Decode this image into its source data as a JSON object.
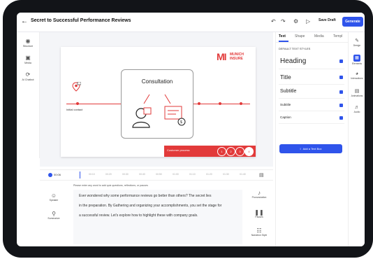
{
  "header": {
    "title": "Secret to Successful Performance Reviews",
    "save_draft": "Save Draft",
    "generate": "Generate"
  },
  "left_rail": {
    "items": [
      {
        "label": "Structure",
        "icon": "structure-icon"
      },
      {
        "label": "Media",
        "icon": "media-icon"
      },
      {
        "label": "AI Chatbot",
        "icon": "ai-chatbot-icon"
      }
    ]
  },
  "slide": {
    "logo_mark": "MI",
    "logo_line1": "MUNICH",
    "logo_line2": "INSURE",
    "consultation": "Consultation",
    "initial_contact": "Initial contact",
    "bar_label": "Customer process",
    "steps": [
      "1",
      "2",
      "3",
      "4"
    ]
  },
  "right_panel": {
    "tabs": [
      "Text",
      "Shape",
      "Media",
      "Templ"
    ],
    "section_title": "DEFAULT TEXT STYLES",
    "styles": [
      "Heading",
      "Title",
      "Subtitle",
      "Subtitle",
      "Caption"
    ],
    "add_button": "Add a Text Box"
  },
  "far_right": {
    "items": [
      {
        "label": "Design",
        "icon": "design-icon"
      },
      {
        "label": "Elements",
        "icon": "elements-icon"
      },
      {
        "label": "Interactions",
        "icon": "interactions-icon"
      },
      {
        "label": "Animations",
        "icon": "animations-icon"
      },
      {
        "label": "Audio",
        "icon": "audio-icon"
      }
    ]
  },
  "timeline": {
    "time": "00:06",
    "ticks": [
      "00:10",
      "00:20",
      "00:30",
      "00:40",
      "00:50",
      "01:00",
      "01:10",
      "01:20",
      "01:30",
      "01:40"
    ]
  },
  "bottom_left": {
    "items": [
      {
        "label": "Speaker"
      },
      {
        "label": "Summarize"
      }
    ]
  },
  "bottom_right": {
    "items": [
      {
        "label": "Pronunciation"
      },
      {
        "label": "Pauses"
      },
      {
        "label": "Narration Style"
      }
    ]
  },
  "script": {
    "notice": "Please enter any word to add quiz questions, reflections, or pauses",
    "line1": "Ever wondered why some performance reviews go better than others? The secret lies",
    "line2": "in the preparation. By Gathering and organizing your accomplishments, you set the stage for",
    "line3": "a successful review. Let's explore how to highlight these with company goals."
  },
  "colors": {
    "accent": "#2f54eb",
    "brand_red": "#e23a3a"
  }
}
